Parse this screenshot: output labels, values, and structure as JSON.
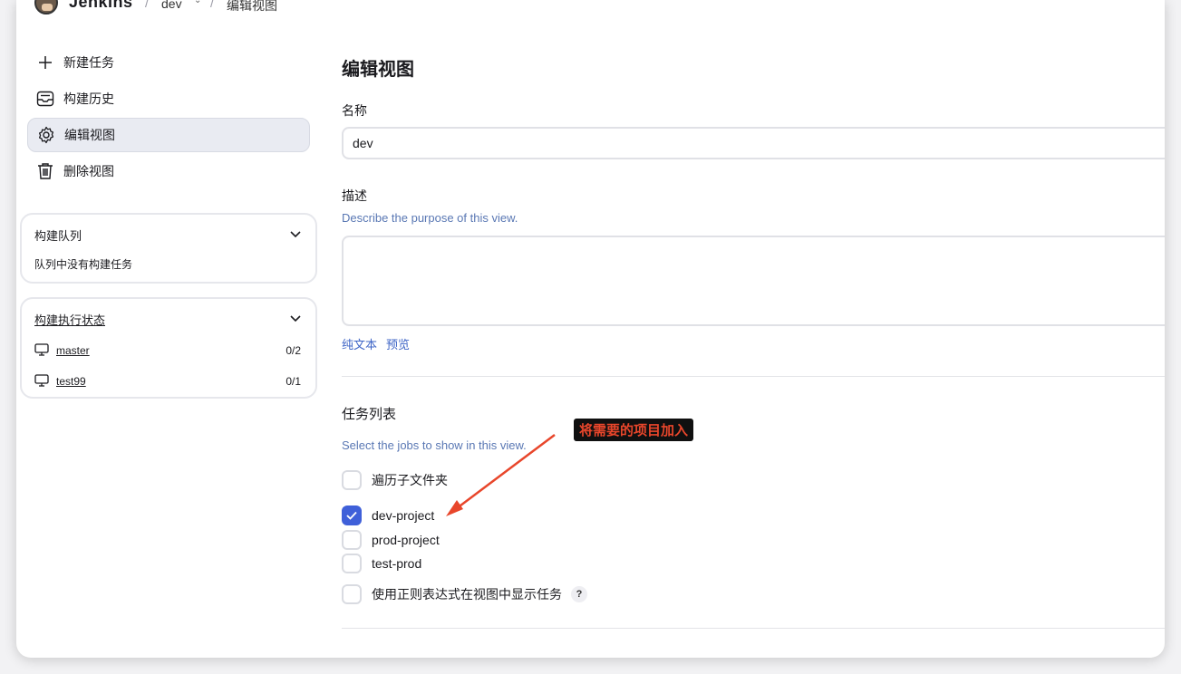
{
  "header": {
    "logo_text": "Jenkins",
    "crumbs": [
      "dev",
      "编辑视图"
    ]
  },
  "sidebar": {
    "tasks": [
      {
        "label": "新建任务",
        "icon": "plus-icon"
      },
      {
        "label": "构建历史",
        "icon": "inbox-icon"
      },
      {
        "label": "编辑视图",
        "icon": "gear-icon",
        "active": true
      },
      {
        "label": "删除视图",
        "icon": "trash-icon"
      }
    ],
    "queue": {
      "title": "构建队列",
      "empty_text": "队列中没有构建任务"
    },
    "executors": {
      "title": "构建执行状态",
      "nodes": [
        {
          "name": "master",
          "count": "0/2"
        },
        {
          "name": "test99",
          "count": "0/1"
        }
      ]
    }
  },
  "main": {
    "title": "编辑视图",
    "name_label": "名称",
    "name_value": "dev",
    "desc_label": "描述",
    "desc_help": "Describe the purpose of this view.",
    "desc_value": "",
    "format_links": [
      "纯文本",
      "预览"
    ],
    "jobs_label": "任务列表",
    "jobs_help": "Select the jobs to show in this view.",
    "recurse_label": "遍历子文件夹",
    "jobs": [
      {
        "name": "dev-project",
        "checked": true
      },
      {
        "name": "prod-project",
        "checked": false
      },
      {
        "name": "test-prod",
        "checked": false
      }
    ],
    "regex_label": "使用正则表达式在视图中显示任务",
    "help_mark": "?"
  },
  "annotation": {
    "text": "将需要的项目加入",
    "color": "#e8462b"
  },
  "colors": {
    "accent": "#3f60d9",
    "link": "#3d64c6",
    "help": "#5a78b4"
  }
}
